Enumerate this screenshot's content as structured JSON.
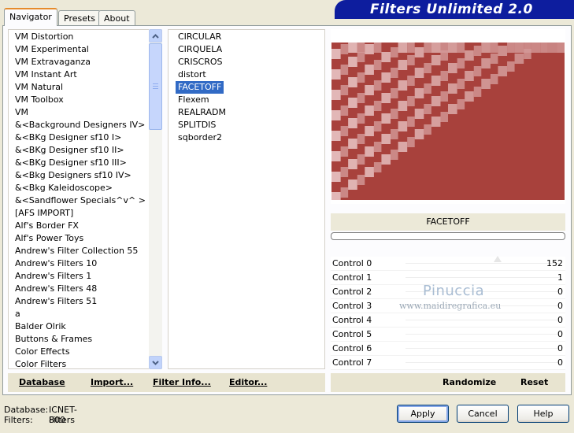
{
  "title": "Filters Unlimited 2.0",
  "tabs": [
    {
      "label": "Navigator",
      "active": true
    },
    {
      "label": "Presets",
      "active": false
    },
    {
      "label": "About",
      "active": false
    }
  ],
  "categories": [
    "VM Distortion",
    "VM Experimental",
    "VM Extravaganza",
    "VM Instant Art",
    "VM Natural",
    "VM Toolbox",
    "VM",
    "&<Background Designers IV>",
    "&<BKg Designer sf10 I>",
    "&<BKg Designer sf10 II>",
    "&<BKg Designer sf10 III>",
    "&<Bkg Designers sf10 IV>",
    "&<Bkg Kaleidoscope>",
    "&<Sandflower Specials^v^ >",
    "[AFS IMPORT]",
    "Alf's Border FX",
    "Alf's Power Toys",
    "Andrew's Filter Collection 55",
    "Andrew's Filters 10",
    "Andrew's Filters 1",
    "Andrew's Filters 48",
    "Andrew's Filters 51",
    "a",
    "Balder Olrik",
    "Buttons & Frames",
    "Color Effects",
    "Color Filters"
  ],
  "filters": {
    "items": [
      "CIRCULAR",
      "CIRQUELA",
      "CRISCROS",
      "distort",
      "FACETOFF",
      "Flexem",
      "REALRADM",
      "SPLITDIS",
      "sqborder2"
    ],
    "selected_index": 4
  },
  "selected_filter": "FACETOFF",
  "controls": [
    {
      "label": "Control 0",
      "value": "152",
      "level": 0.6
    },
    {
      "label": "Control 1",
      "value": "1",
      "level": 0.0
    },
    {
      "label": "Control 2",
      "value": "0",
      "level": 0.0
    },
    {
      "label": "Control 3",
      "value": "0",
      "level": 0.0
    },
    {
      "label": "Control 4",
      "value": "0",
      "level": 0.0
    },
    {
      "label": "Control 5",
      "value": "0",
      "level": 0.0
    },
    {
      "label": "Control 6",
      "value": "0",
      "level": 0.0
    },
    {
      "label": "Control 7",
      "value": "0",
      "level": 0.0
    }
  ],
  "left_actions": {
    "database": "Database",
    "import": "Import...",
    "filter_info": "Filter Info...",
    "editor": "Editor..."
  },
  "right_actions": {
    "randomize": "Randomize",
    "reset": "Reset"
  },
  "status": {
    "database_label": "Database:",
    "database_value": "ICNET-Filters",
    "filters_label": "Filters:",
    "filters_value": "800"
  },
  "buttons": {
    "apply": "Apply",
    "cancel": "Cancel",
    "help": "Help"
  },
  "watermark": {
    "name": "Pinuccia",
    "url": "www.maidiregrafica.eu"
  },
  "colors": {
    "banner": "#0d1d9e",
    "selection": "#316ac5",
    "preview_dark": "#a8413c",
    "preview_light": "#e8c4c4"
  }
}
